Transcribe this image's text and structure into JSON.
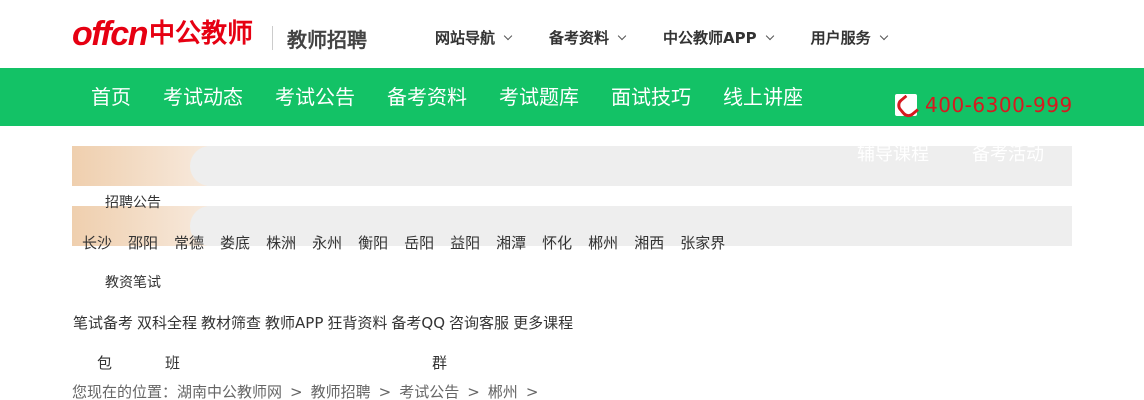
{
  "header": {
    "logo_text": "offcn",
    "logo_cn": "中公教师",
    "subtitle": "教师招聘",
    "top_nav": [
      {
        "label": "网站导航"
      },
      {
        "label": "备考资料"
      },
      {
        "label": "中公教师APP"
      },
      {
        "label": "用户服务"
      }
    ]
  },
  "main_nav": {
    "items": [
      "首页",
      "考试动态",
      "考试公告",
      "备考资料",
      "考试题库",
      "面试技巧",
      "线上讲座"
    ],
    "hotline": "400-6300-999"
  },
  "banner": {
    "tab_1": "辅导课程",
    "tab_2": "备考活动"
  },
  "recruit": {
    "label": "招聘公告",
    "cities": [
      "长沙",
      "邵阳",
      "常德",
      "娄底",
      "株洲",
      "永州",
      "衡阳",
      "岳阳",
      "益阳",
      "湘潭",
      "怀化",
      "郴州",
      "湘西",
      "张家界"
    ]
  },
  "study": {
    "label": "教资笔试",
    "links": [
      "笔试备考",
      "双科全程",
      "教材筛查",
      "教师APP",
      "狂背资料",
      "备考QQ",
      "咨询客服",
      "更多课程"
    ],
    "tags": [
      "包",
      "班",
      "群"
    ]
  },
  "breadcrumb": {
    "prefix": "您现在的位置：",
    "items": [
      "湖南中公教师网",
      "教师招聘",
      "考试公告",
      "郴州"
    ],
    "separator": ">"
  },
  "colors": {
    "brand_red": "#e60012",
    "nav_green": "#13c266",
    "hotline_red": "#d7191f"
  }
}
